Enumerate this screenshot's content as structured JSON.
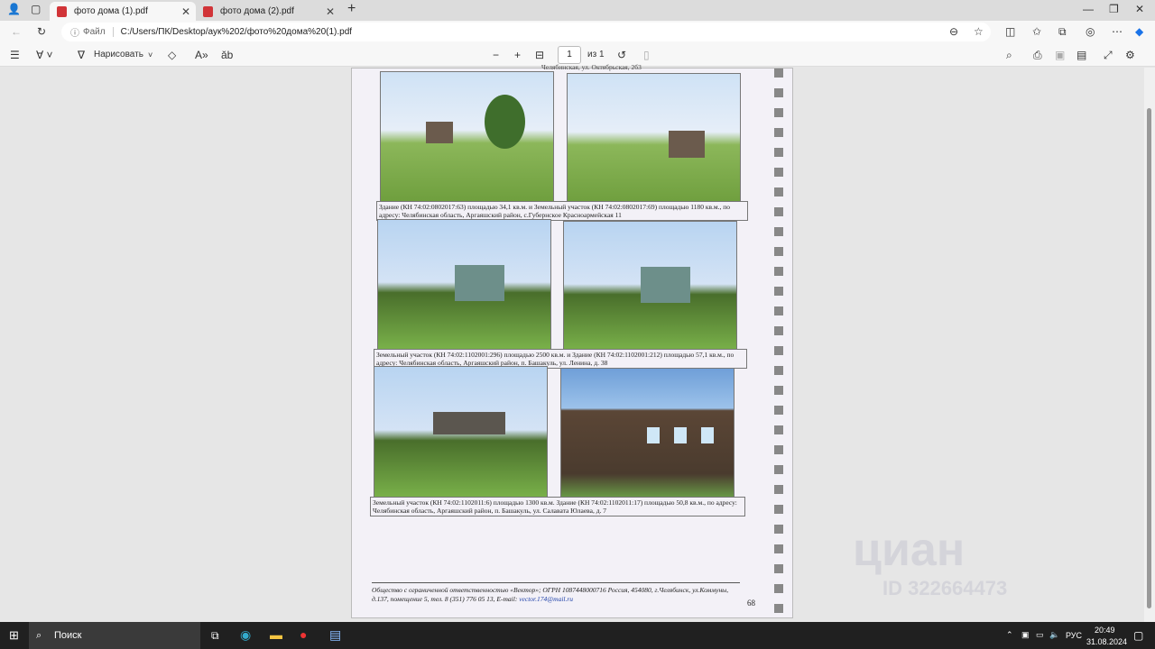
{
  "tabs": [
    {
      "title": "фото дома (1).pdf",
      "active": true
    },
    {
      "title": "фото дома (2).pdf",
      "active": false
    }
  ],
  "address": {
    "label": "Файл",
    "url": "C:/Users/ПК/Desktop/аук%202/фото%20дома%20(1).pdf"
  },
  "toolbar": {
    "draw_label": "Нарисовать",
    "page_current": "1",
    "page_total": "из 1"
  },
  "document": {
    "top_cut_text": "Челябинская, ул. Октябрьская, 2б3",
    "captions": [
      "Здание (КН 74:02:0802017:63) площадью 34,1 кв.м. и Земельный участок (КН 74:02:0802017:69) площадью 1180 кв.м., по адресу: Челябинская область, Аргаяшский район, с.Губернское Красноармейская 11",
      "Земельный участок (КН 74:02:1102001:296) площадью 2500 кв.м. и Здание (КН 74:02:1102001:212) площадью 57,1 кв.м., по адресу: Челябинская область, Аргаяшский район, п. Башакуль, ул. Ленина, д. 38",
      "Земельный участок (КН 74:02:1102011:6) площадью 1300 кв.м. Здание (КН 74:02:1102011:17) площадью 50,8 кв.м., по адресу: Челябинская область, Аргаяшский район, п. Башакуль, ул. Салавата Юлаева, д. 7"
    ],
    "footer_text": "Общество с ограниченной ответственностью «Вектор»; ОГРН 1087448000716 Россия, 454080, г.Челябинск, ул.Коммуны, д.137, помещение 5, тел. 8 (351) 776 05 13, E-mail:",
    "footer_email": "vector.174@mail.ru",
    "page_number": "68",
    "watermark": "циан",
    "watermark_id": "ID 322664473"
  },
  "taskbar": {
    "search": "Поиск",
    "lang": "РУС",
    "time": "20:49",
    "date": "31.08.2024"
  }
}
